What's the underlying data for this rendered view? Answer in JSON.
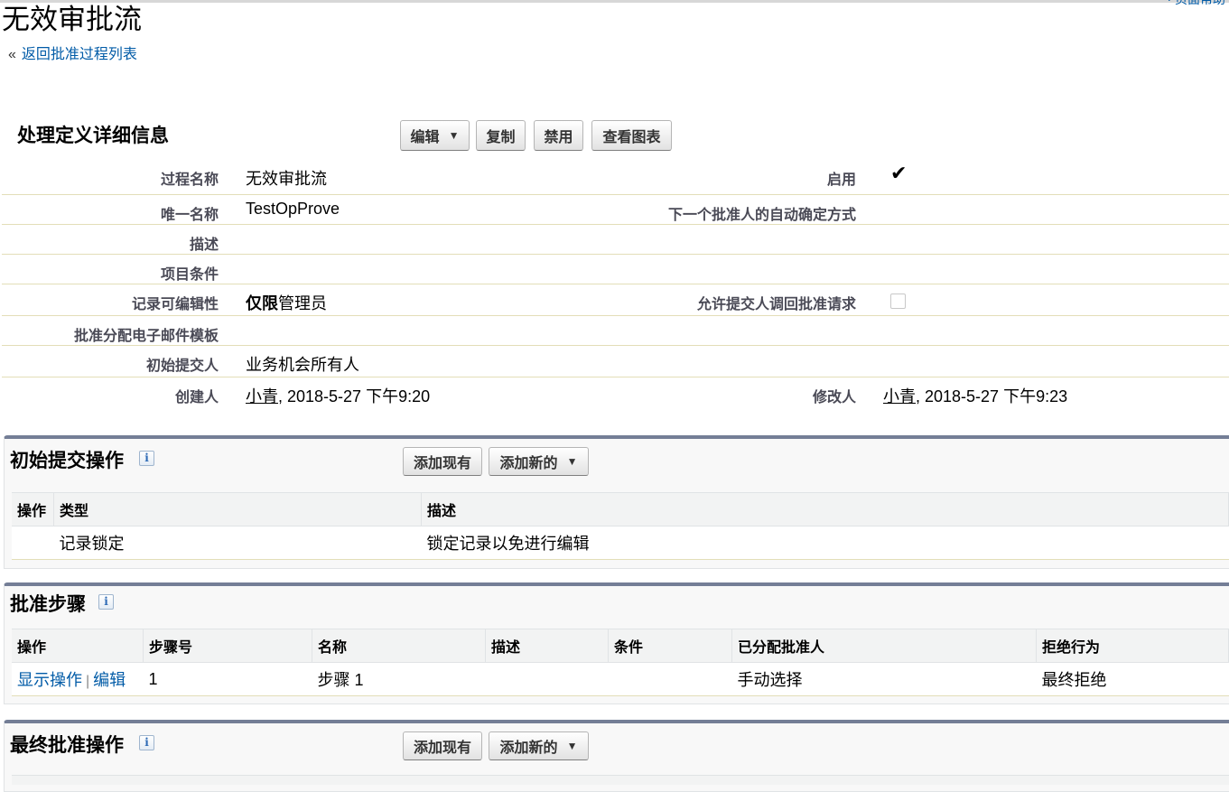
{
  "header": {
    "title": "无效审批流",
    "back_prefix": "«",
    "back_link": "返回批准过程列表",
    "corner_link": "· 页面帮助"
  },
  "detail": {
    "section_title": "处理定义详细信息",
    "buttons": {
      "edit": "编辑",
      "copy": "复制",
      "disable": "禁用",
      "view_chart": "查看图表"
    },
    "labels": {
      "process_name": "过程名称",
      "unique_name": "唯一名称",
      "description": "描述",
      "entry_criteria": "项目条件",
      "record_editability": "记录可编辑性",
      "email_template": "批准分配电子邮件模板",
      "initial_submitter": "初始提交人",
      "created_by": "创建人",
      "active": "启用",
      "next_approver": "下一个批准人的自动确定方式",
      "allow_recall": "允许提交人调回批准请求",
      "modified_by": "修改人"
    },
    "values": {
      "process_name": "无效审批流",
      "unique_name": "TestOpProve",
      "editability_bold": "仅限",
      "editability_rest": "管理员",
      "initial_submitter": "业务机会所有人",
      "created_user": "小青",
      "created_date": ", 2018-5-27 下午9:20",
      "modified_user": "小青",
      "modified_date": ", 2018-5-27 下午9:23"
    },
    "active_checked": true,
    "allow_recall_checked": false
  },
  "initial_actions": {
    "title": "初始提交操作",
    "info_glyph": "i",
    "add_existing": "添加现有",
    "add_new": "添加新的",
    "headers": [
      "操作",
      "类型",
      "描述"
    ],
    "rows": [
      {
        "action": "",
        "type": "记录锁定",
        "description": "锁定记录以免进行编辑"
      }
    ]
  },
  "approval_steps": {
    "title": "批准步骤",
    "info_glyph": "i",
    "headers": [
      "操作",
      "步骤号",
      "名称",
      "描述",
      "条件",
      "已分配批准人",
      "拒绝行为"
    ],
    "rows": [
      {
        "show_action": "显示操作",
        "separator": "|",
        "edit": "编辑",
        "step": "1",
        "name": "步骤 1",
        "description": "",
        "criteria": "",
        "approver": "手动选择",
        "reject": "最终拒绝"
      }
    ]
  },
  "final_approval": {
    "title": "最终批准操作",
    "info_glyph": "i",
    "add_existing": "添加现有",
    "add_new": "添加新的"
  },
  "icons": {
    "dropdown": "triangle-down-icon",
    "check": "checkmark-icon",
    "info": "info-icon"
  }
}
